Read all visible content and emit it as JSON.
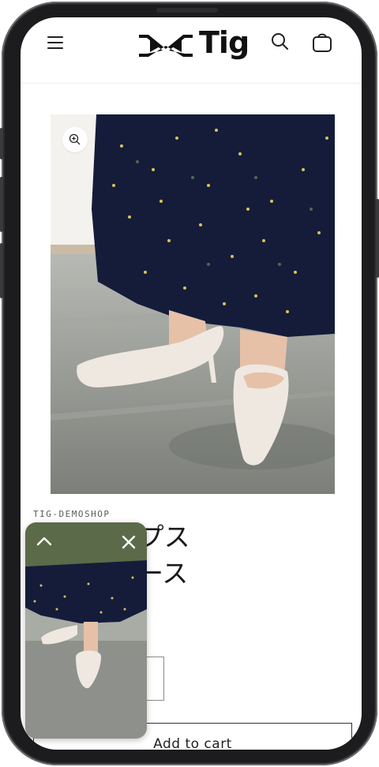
{
  "header": {
    "menu_icon": "hamburger-menu-icon",
    "logo_text": "Tig",
    "search_icon": "search-icon",
    "cart_icon": "cart-icon"
  },
  "product": {
    "image_alt": "product photo",
    "zoom_icon": "zoom-in-icon",
    "vendor": "TIG-DEMOSHOP",
    "title_visible": "ッドパンプス\n-) レディース",
    "add_to_cart_label": "Add to cart"
  },
  "floating_video": {
    "expand_icon": "chevron-up-icon",
    "close_icon": "close-icon"
  },
  "colors": {
    "frame": "#1c1c1e",
    "text": "#1a1a1a",
    "border": "#333333"
  }
}
